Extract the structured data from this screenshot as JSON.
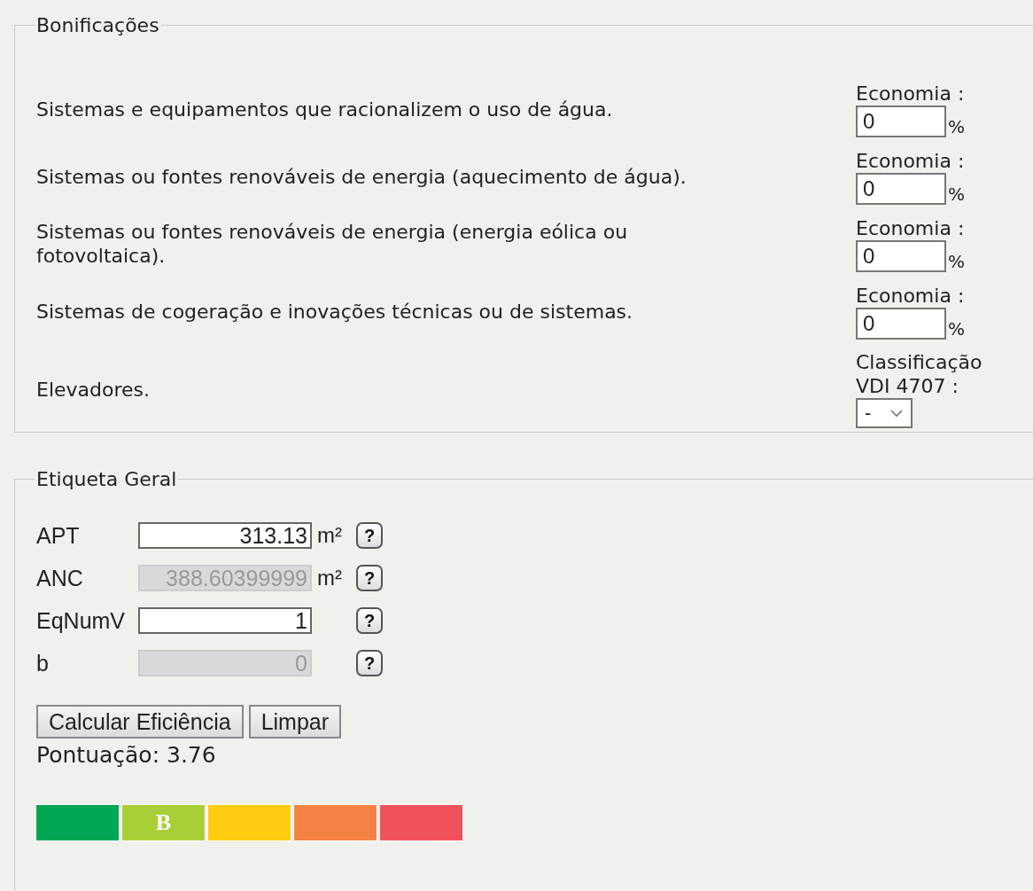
{
  "bonificacoes": {
    "legend": "Bonificações",
    "rows": [
      {
        "text": "Sistemas e equipamentos que racionalizem o uso de água.",
        "kind": "percent",
        "label": "Economia :",
        "value": "0",
        "unit": "%"
      },
      {
        "text": "Sistemas ou fontes renováveis de energia (aquecimento de água).",
        "kind": "percent",
        "label": "Economia :",
        "value": "0",
        "unit": "%"
      },
      {
        "text": "Sistemas ou fontes renováveis de energia (energia eólica ou fotovoltaica).",
        "kind": "percent",
        "label": "Economia :",
        "value": "0",
        "unit": "%"
      },
      {
        "text": "Sistemas de cogeração e inovações técnicas ou de sistemas.",
        "kind": "percent",
        "label": "Economia :",
        "value": "0",
        "unit": "%"
      },
      {
        "text": "Elevadores.",
        "kind": "select",
        "label": "Classificação VDI 4707 :",
        "value": "-"
      }
    ]
  },
  "etiqueta": {
    "legend": "Etiqueta Geral",
    "fields": [
      {
        "label": "APT",
        "value": "313.13",
        "disabled": false,
        "unit": "m²",
        "help": "?"
      },
      {
        "label": "ANC",
        "value": "388.60399999",
        "disabled": true,
        "unit": "m²",
        "help": "?"
      },
      {
        "label": "EqNumV",
        "value": "1",
        "disabled": false,
        "help": "?"
      },
      {
        "label": "b",
        "value": "0",
        "disabled": true,
        "help": "?"
      }
    ],
    "buttons": [
      "Calcular Eficiência",
      "Limpar"
    ],
    "score": "Pontuação: 3.76",
    "rating": [
      {
        "color": "#00a651"
      },
      {
        "color": "#a8cf38",
        "label": "B"
      },
      {
        "color": "#ffcc11"
      },
      {
        "color": "#f58345"
      },
      {
        "color": "#f0525b"
      }
    ]
  }
}
